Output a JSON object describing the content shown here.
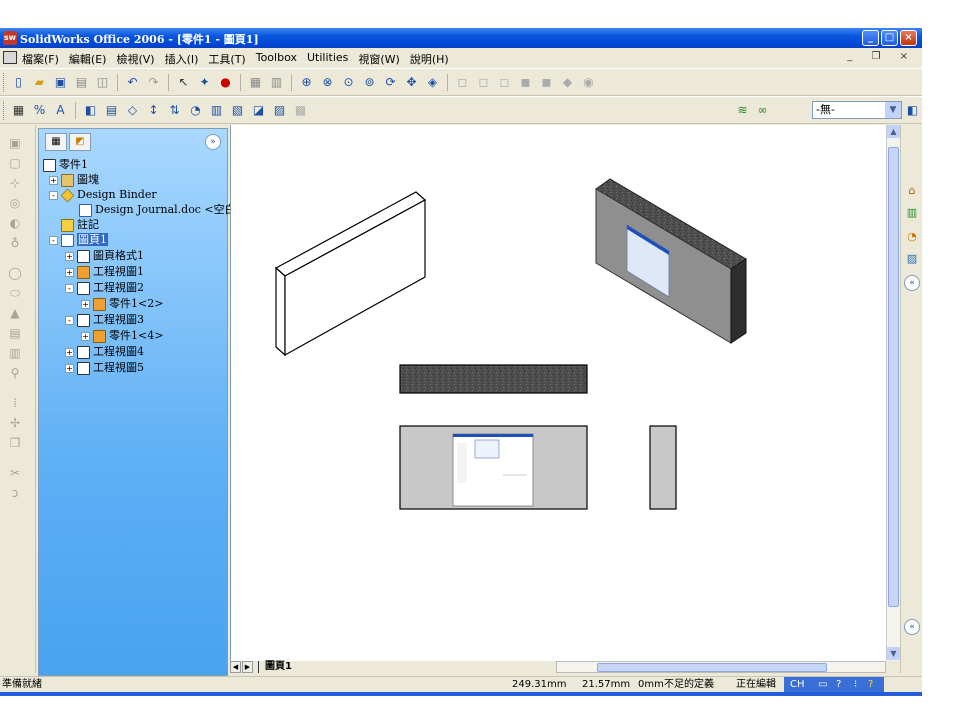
{
  "window": {
    "title": "SolidWorks Office 2006 - [零件1 - 圖頁1]",
    "app_icon": "sw",
    "controls": {
      "minimize": "_",
      "maximize": "□",
      "close": "×"
    }
  },
  "menu": {
    "items": [
      "檔案(F)",
      "編輯(E)",
      "檢視(V)",
      "插入(I)",
      "工具(T)",
      "Toolbox",
      "Utilities",
      "視窗(W)",
      "說明(H)"
    ],
    "mdi_controls": "_ ❐ ×"
  },
  "toolbar1": {
    "icons": [
      "new-icon",
      "open-icon",
      "save-icon",
      "print-icon",
      "print-preview-icon",
      "undo-icon",
      "redo-icon",
      "select-icon",
      "rebuild-icon",
      "options-icon",
      "zoom-fit-icon",
      "zoom-area-icon",
      "zoom-in-out-icon",
      "zoom-selection-icon",
      "rotate-icon",
      "pan-icon",
      "view-orientation-icon"
    ]
  },
  "toolbar2": {
    "icons": [
      "sheet-format-icon",
      "dimension-icon",
      "annotation-icon",
      "model-view-icon",
      "projected-view-icon",
      "section-view-icon",
      "detail-view-icon",
      "break-view-icon",
      "crop-view-icon"
    ],
    "layer_value": "-無-"
  },
  "tree": {
    "tabs": [
      "feature-manager-tab",
      "property-manager-tab"
    ],
    "nodes": [
      {
        "label": "零件1",
        "icon": "drawing-icon",
        "level": 0,
        "toggle": ""
      },
      {
        "label": "圖塊",
        "icon": "blocks-folder-icon",
        "level": 1,
        "toggle": "+"
      },
      {
        "label": "Design Binder",
        "icon": "design-binder-icon",
        "level": 1,
        "toggle": "-"
      },
      {
        "label": "Design Journal.doc <空白>",
        "icon": "word-doc-icon",
        "level": 2,
        "toggle": ""
      },
      {
        "label": "註記",
        "icon": "annotations-icon",
        "level": 1,
        "toggle": ""
      },
      {
        "label": "圖頁1",
        "icon": "sheet-icon",
        "level": 1,
        "toggle": "-",
        "selected": true
      },
      {
        "label": "圖頁格式1",
        "icon": "sheet-format-icon",
        "level": 2,
        "toggle": "+"
      },
      {
        "label": "工程視圖1",
        "icon": "drawing-view-icon",
        "level": 2,
        "toggle": "+"
      },
      {
        "label": "工程視圖2",
        "icon": "drawing-view-icon",
        "level": 2,
        "toggle": "-"
      },
      {
        "label": "零件1<2>",
        "icon": "part-icon",
        "level": 3,
        "toggle": "+"
      },
      {
        "label": "工程視圖3",
        "icon": "drawing-view-icon",
        "level": 2,
        "toggle": "-"
      },
      {
        "label": "零件1<4>",
        "icon": "part-icon",
        "level": 3,
        "toggle": "+"
      },
      {
        "label": "工程視圖4",
        "icon": "drawing-view-icon",
        "level": 2,
        "toggle": "+"
      },
      {
        "label": "工程視圖5",
        "icon": "drawing-view-icon",
        "level": 2,
        "toggle": "+"
      }
    ]
  },
  "sheet_tabs": {
    "active": "圖頁1"
  },
  "status": {
    "left": "準備就緒",
    "x": "249.31mm",
    "y": "21.57mm",
    "z": "0mm",
    "definition": "不足的定義",
    "mode": "正在編輯",
    "ime": "CH"
  },
  "colors": {
    "titlebar": "#0a56dc",
    "tree_bg": "#5fb0f5",
    "selection": "#316ac5",
    "textured_face": "#4a4a4a",
    "shaded_gray": "#c8c8c8"
  }
}
